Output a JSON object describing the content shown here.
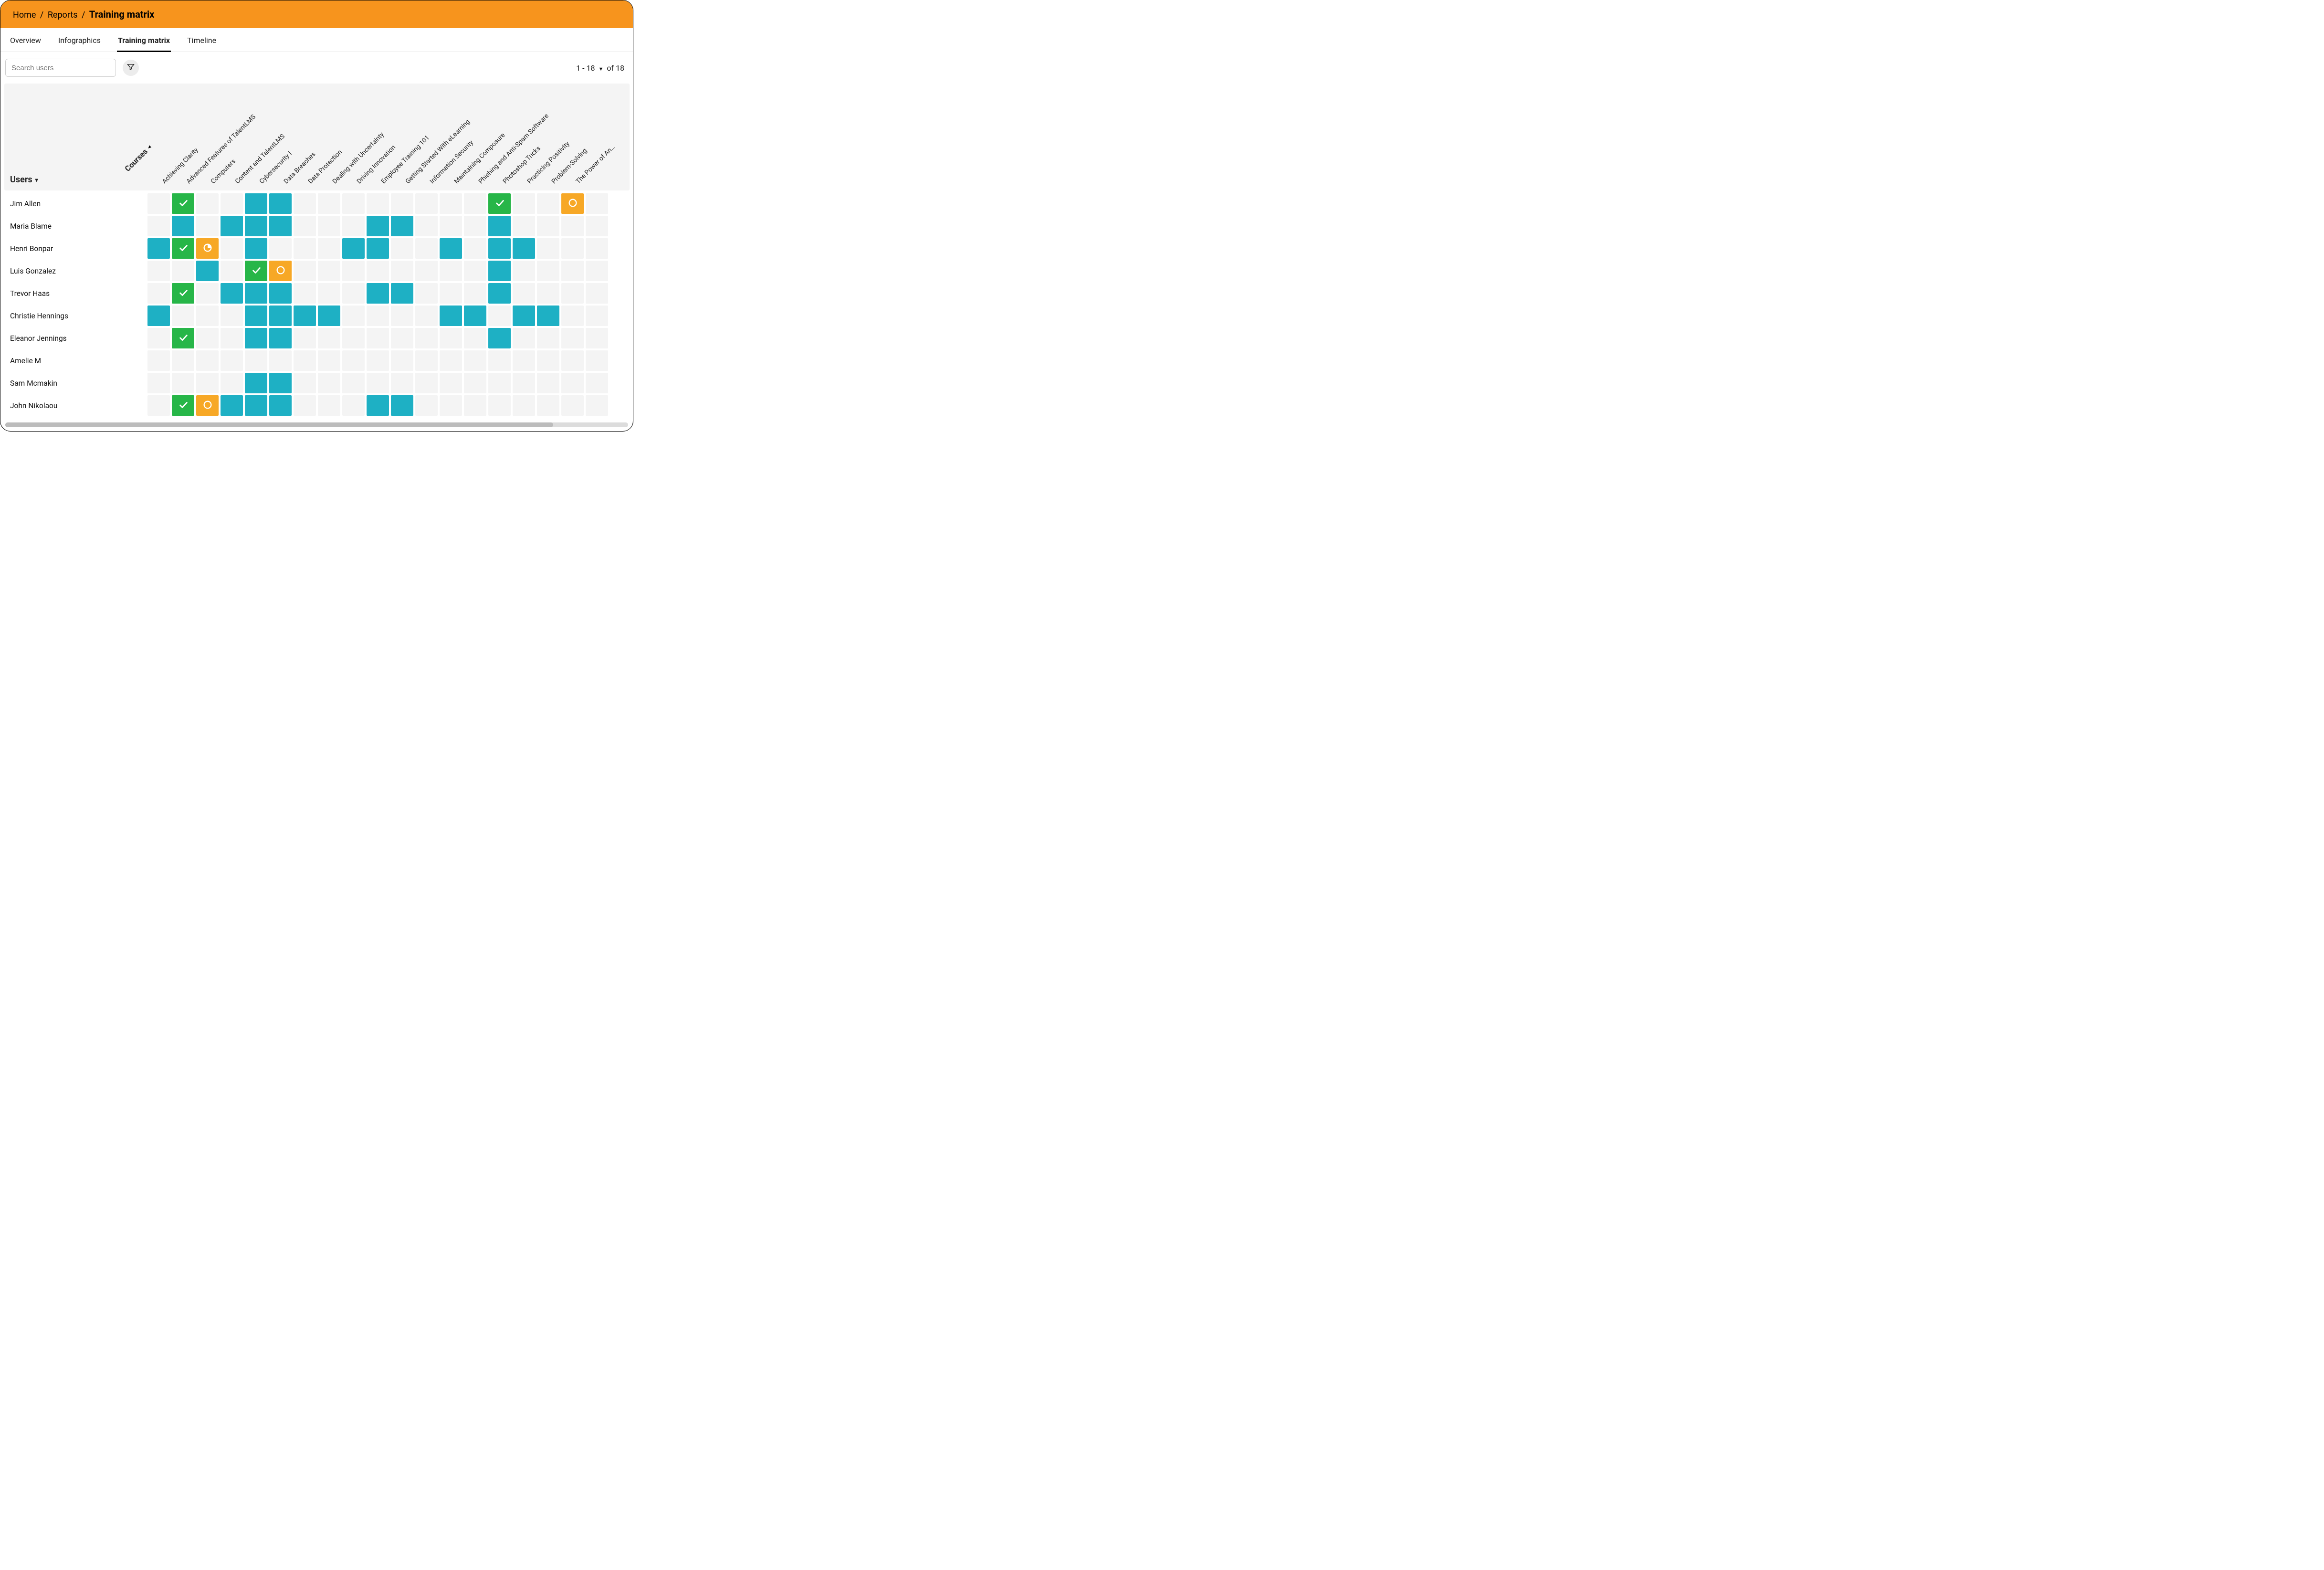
{
  "breadcrumb": {
    "home": "Home",
    "reports": "Reports",
    "current": "Training matrix"
  },
  "tabs": [
    {
      "id": "overview",
      "label": "Overview",
      "active": false
    },
    {
      "id": "infographics",
      "label": "Infographics",
      "active": false
    },
    {
      "id": "training-matrix",
      "label": "Training matrix",
      "active": true
    },
    {
      "id": "timeline",
      "label": "Timeline",
      "active": false
    }
  ],
  "search": {
    "placeholder": "Search users",
    "value": ""
  },
  "pagination": {
    "range_text": "1 - 18",
    "suffix": "of 18"
  },
  "columns_label": "Courses",
  "rows_label": "Users",
  "courses": [
    "Achieving Clarity",
    "Advanced Features of TalentLMS",
    "Computers",
    "Content and TalentLMS",
    "Cybersecurity I",
    "Data Breaches",
    "Data Protection",
    "Dealing with Uncertainty",
    "Driving Innovation",
    "Employee Training 101",
    "Getting Started With eLearning",
    "Information Security",
    "Maintaining Composure",
    "Phishing and Anti-Spam Software",
    "Photoshop Tricks",
    "Practicing Positivity",
    "Problem-Solving",
    "The Power of An…"
  ],
  "cell_status_legend": {
    "none": "no background / empty",
    "enrolled": "teal filled — enrolled / not started in course view",
    "completed": "green + check icon",
    "inprogress": "orange + pie icon (partial)",
    "notstarted": "orange + ring icon (not started)"
  },
  "users": [
    {
      "name": "Jim Allen",
      "cells": [
        "none",
        "completed",
        "none",
        "none",
        "enrolled",
        "enrolled",
        "none",
        "none",
        "none",
        "none",
        "none",
        "none",
        "none",
        "none",
        "completed",
        "none",
        "none",
        "notstarted",
        "none"
      ]
    },
    {
      "name": "Maria Blame",
      "cells": [
        "none",
        "enrolled",
        "none",
        "enrolled",
        "enrolled",
        "enrolled",
        "none",
        "none",
        "none",
        "enrolled",
        "enrolled",
        "none",
        "none",
        "none",
        "enrolled",
        "none",
        "none",
        "none",
        "none"
      ]
    },
    {
      "name": "Henri Bonpar",
      "cells": [
        "enrolled",
        "completed",
        "inprogress",
        "none",
        "enrolled",
        "none",
        "none",
        "none",
        "enrolled",
        "enrolled",
        "none",
        "none",
        "enrolled",
        "none",
        "enrolled",
        "enrolled",
        "none",
        "none",
        "none"
      ]
    },
    {
      "name": "Luis Gonzalez",
      "cells": [
        "none",
        "none",
        "enrolled",
        "none",
        "completed",
        "notstarted",
        "none",
        "none",
        "none",
        "none",
        "none",
        "none",
        "none",
        "none",
        "enrolled",
        "none",
        "none",
        "none",
        "none"
      ]
    },
    {
      "name": "Trevor Haas",
      "cells": [
        "none",
        "completed",
        "none",
        "enrolled",
        "enrolled",
        "enrolled",
        "none",
        "none",
        "none",
        "enrolled",
        "enrolled",
        "none",
        "none",
        "none",
        "enrolled",
        "none",
        "none",
        "none",
        "none"
      ]
    },
    {
      "name": "Christie Hennings",
      "cells": [
        "enrolled",
        "none",
        "none",
        "none",
        "enrolled",
        "enrolled",
        "enrolled",
        "enrolled",
        "none",
        "none",
        "none",
        "none",
        "enrolled",
        "enrolled",
        "none",
        "enrolled",
        "enrolled",
        "none",
        "none"
      ]
    },
    {
      "name": "Eleanor Jennings",
      "cells": [
        "none",
        "completed",
        "none",
        "none",
        "enrolled",
        "enrolled",
        "none",
        "none",
        "none",
        "none",
        "none",
        "none",
        "none",
        "none",
        "enrolled",
        "none",
        "none",
        "none",
        "none"
      ]
    },
    {
      "name": "Amelie M",
      "cells": [
        "none",
        "none",
        "none",
        "none",
        "none",
        "none",
        "none",
        "none",
        "none",
        "none",
        "none",
        "none",
        "none",
        "none",
        "none",
        "none",
        "none",
        "none",
        "none"
      ]
    },
    {
      "name": "Sam Mcmakin",
      "cells": [
        "none",
        "none",
        "none",
        "none",
        "enrolled",
        "enrolled",
        "none",
        "none",
        "none",
        "none",
        "none",
        "none",
        "none",
        "none",
        "none",
        "none",
        "none",
        "none",
        "none"
      ]
    },
    {
      "name": "John Nikolaou",
      "cells": [
        "none",
        "completed",
        "notstarted",
        "enrolled",
        "enrolled",
        "enrolled",
        "none",
        "none",
        "none",
        "enrolled",
        "enrolled",
        "none",
        "none",
        "none",
        "none",
        "none",
        "none",
        "none",
        "none"
      ]
    }
  ]
}
